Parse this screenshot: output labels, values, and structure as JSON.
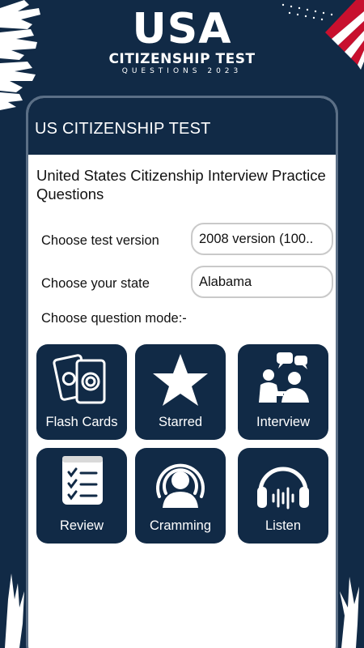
{
  "promo": {
    "title": "USA",
    "subtitle": "CITIZENSHIP TEST",
    "tagline": "QUESTIONS 2023"
  },
  "appbar": {
    "title": "US CITIZENSHIP TEST"
  },
  "main": {
    "headline": "United States Citizenship Interview Practice Questions",
    "version_label": "Choose test version",
    "version_value": "2008 version (100..",
    "state_label": "Choose your state",
    "state_value": "Alabama",
    "mode_label": "Choose question mode:-"
  },
  "modes": [
    {
      "label": "Flash Cards",
      "icon": "flash-cards-icon"
    },
    {
      "label": "Starred",
      "icon": "star-icon"
    },
    {
      "label": "Interview",
      "icon": "interview-icon"
    },
    {
      "label": "Review",
      "icon": "checklist-icon"
    },
    {
      "label": "Cramming",
      "icon": "podcast-person-icon"
    },
    {
      "label": "Listen",
      "icon": "headphones-icon"
    }
  ],
  "colors": {
    "navy": "#112a46",
    "flag_red": "#c8102e",
    "white": "#ffffff"
  }
}
